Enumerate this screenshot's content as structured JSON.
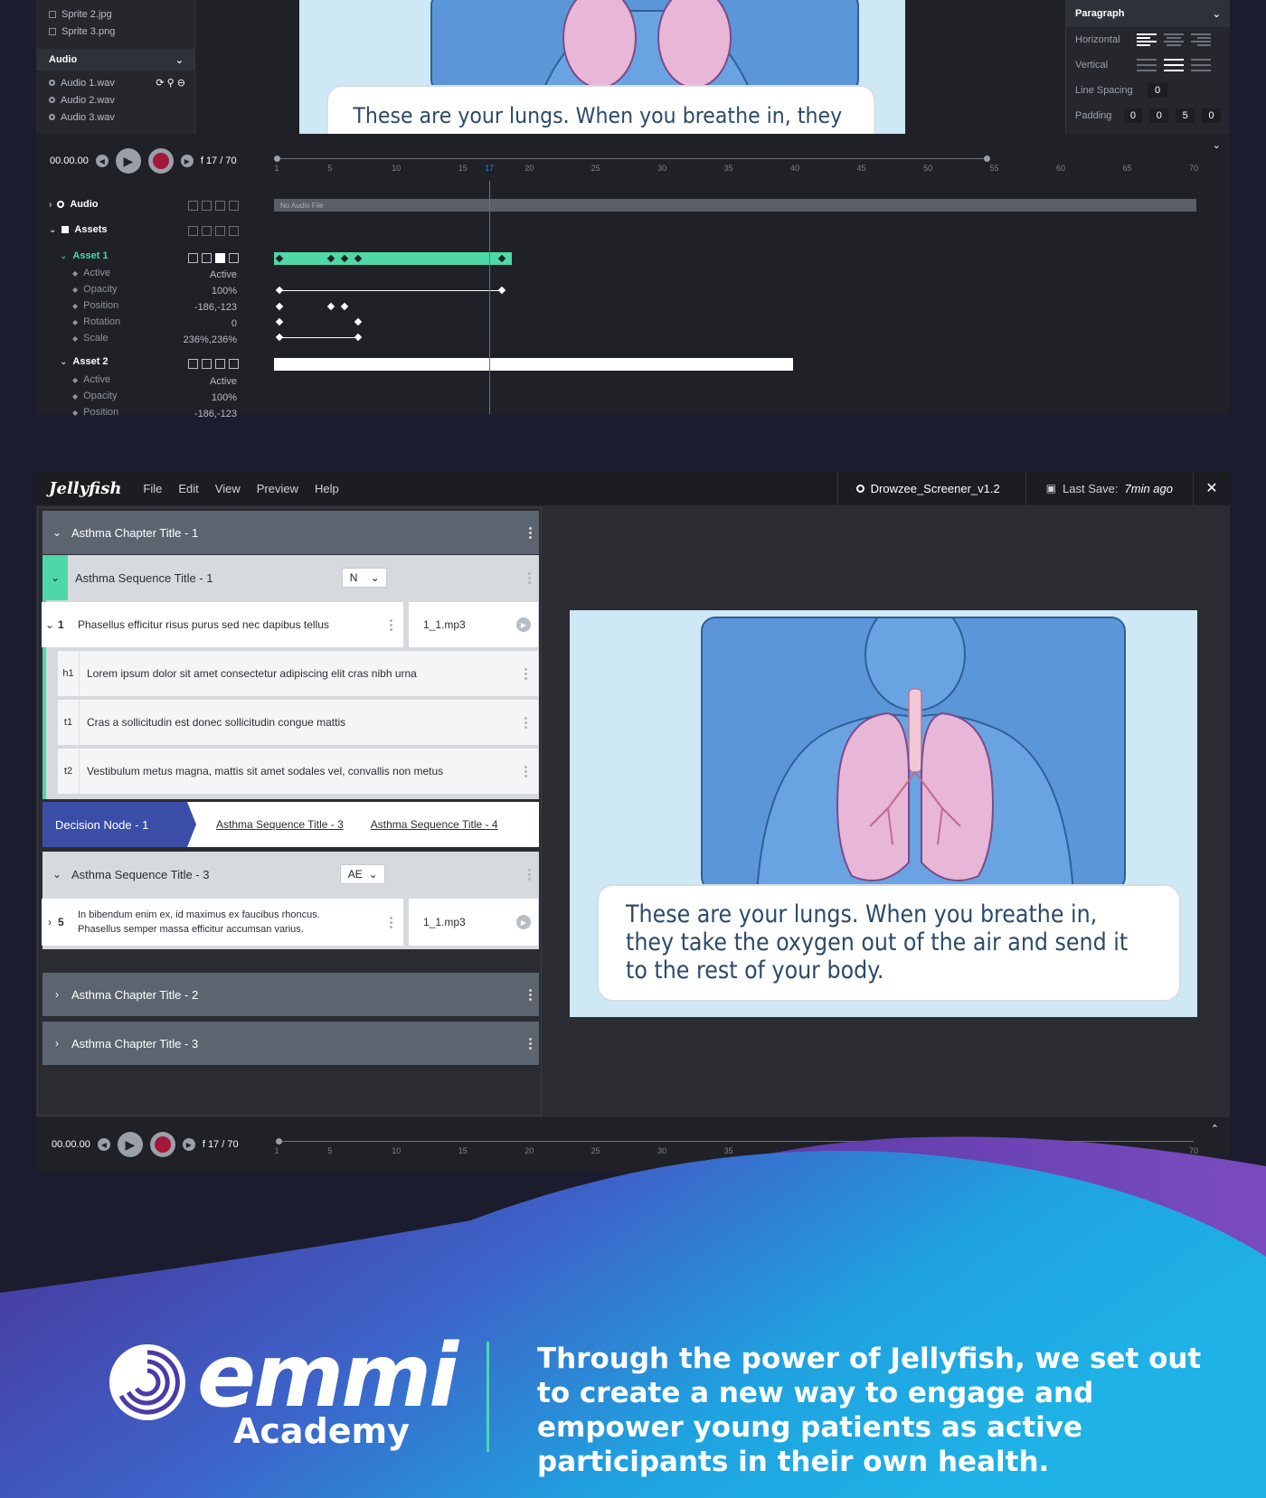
{
  "top_panel": {
    "sprites": [
      "Sprite 2.jpg",
      "Sprite 3.png"
    ],
    "audio_header": "Audio",
    "audio_files": [
      "Audio 1.wav",
      "Audio 2.wav",
      "Audio 3.wav"
    ],
    "preview_caption": "These are your lungs. When you breathe in, they",
    "paragraph": {
      "title": "Paragraph",
      "horizontal_label": "Horizontal",
      "vertical_label": "Vertical",
      "line_spacing_label": "Line Spacing",
      "line_spacing_value": "0",
      "padding_label": "Padding",
      "padding_values": [
        "0",
        "0",
        "5",
        "0"
      ]
    },
    "transport": {
      "time": "00.00.00",
      "frame": "f 17 / 70"
    },
    "timeline": {
      "ticks": [
        "1",
        "5",
        "10",
        "15",
        "17",
        "20",
        "25",
        "30",
        "35",
        "40",
        "45",
        "50",
        "55",
        "60",
        "65",
        "70"
      ],
      "audio_track": "Audio",
      "no_audio": "No Audio File",
      "assets_track": "Assets",
      "asset1": {
        "name": "Asset 1",
        "props": [
          {
            "name": "Active",
            "value": "Active"
          },
          {
            "name": "Opacity",
            "value": "100%"
          },
          {
            "name": "Position",
            "value": "-186,-123"
          },
          {
            "name": "Rotation",
            "value": "0"
          },
          {
            "name": "Scale",
            "value": "236%,236%"
          }
        ]
      },
      "asset2": {
        "name": "Asset 2",
        "props": [
          {
            "name": "Active",
            "value": "Active"
          },
          {
            "name": "Opacity",
            "value": "100%"
          },
          {
            "name": "Position",
            "value": "-186,-123"
          }
        ]
      }
    }
  },
  "editor": {
    "brand": "Jellyfish",
    "menu": [
      "File",
      "Edit",
      "View",
      "Preview",
      "Help"
    ],
    "file_name": "Drowzee_Screener_v1.2",
    "last_save_label": "Last Save:",
    "last_save_value": "7min ago",
    "outline": {
      "chapter1": "Asthma Chapter Title - 1",
      "sequence1": {
        "title": "Asthma Sequence Title - 1",
        "lang": "N"
      },
      "scene1": {
        "number": "1",
        "text": "Phasellus efficitur risus purus sed nec dapibus tellus",
        "audio": "1_1.mp3"
      },
      "text_rows": [
        {
          "tag": "h1",
          "text": "Lorem ipsum dolor sit amet consectetur adipiscing elit cras nibh urna"
        },
        {
          "tag": "t1",
          "text": "Cras a sollicitudin est donec sollicitudin congue mattis"
        },
        {
          "tag": "t2",
          "text": "Vestibulum metus magna, mattis sit amet sodales vel, convallis non metus"
        }
      ],
      "decision": {
        "label": "Decision Node - 1",
        "link1": "Asthma Sequence Title - 3",
        "link2": "Asthma Sequence Title - 4"
      },
      "sequence3": {
        "title": "Asthma Sequence Title - 3",
        "lang": "AE"
      },
      "scene5": {
        "number": "5",
        "line1": "In bibendum enim ex, id maximus ex faucibus rhoncus.",
        "line2": "Phasellus semper massa efficitur accumsan varius.",
        "audio": "1_1.mp3"
      },
      "chapter2": "Asthma Chapter Title - 2",
      "chapter3": "Asthma Chapter Title - 3"
    },
    "preview_caption": "These are your lungs. When you breathe in, they take the oxygen out of the air and send it to the rest of your body.",
    "transport": {
      "time": "00.00.00",
      "frame": "f 17 / 70"
    },
    "ticks": [
      "1",
      "5",
      "10",
      "15",
      "20",
      "25",
      "30",
      "35",
      "70"
    ]
  },
  "footer": {
    "logo_word": "emmi",
    "logo_sub": "Academy",
    "tagline": "Through the power of Jellyfish, we set out to create a new way to engage and empower young patients as active participants in their own health."
  },
  "colors": {
    "accent_green": "#4ed8a7",
    "decision_blue": "#3a4ea8",
    "record_red": "#a3173a",
    "gradient_purple": "#5b3aa8",
    "gradient_cyan": "#1fb2e6"
  }
}
